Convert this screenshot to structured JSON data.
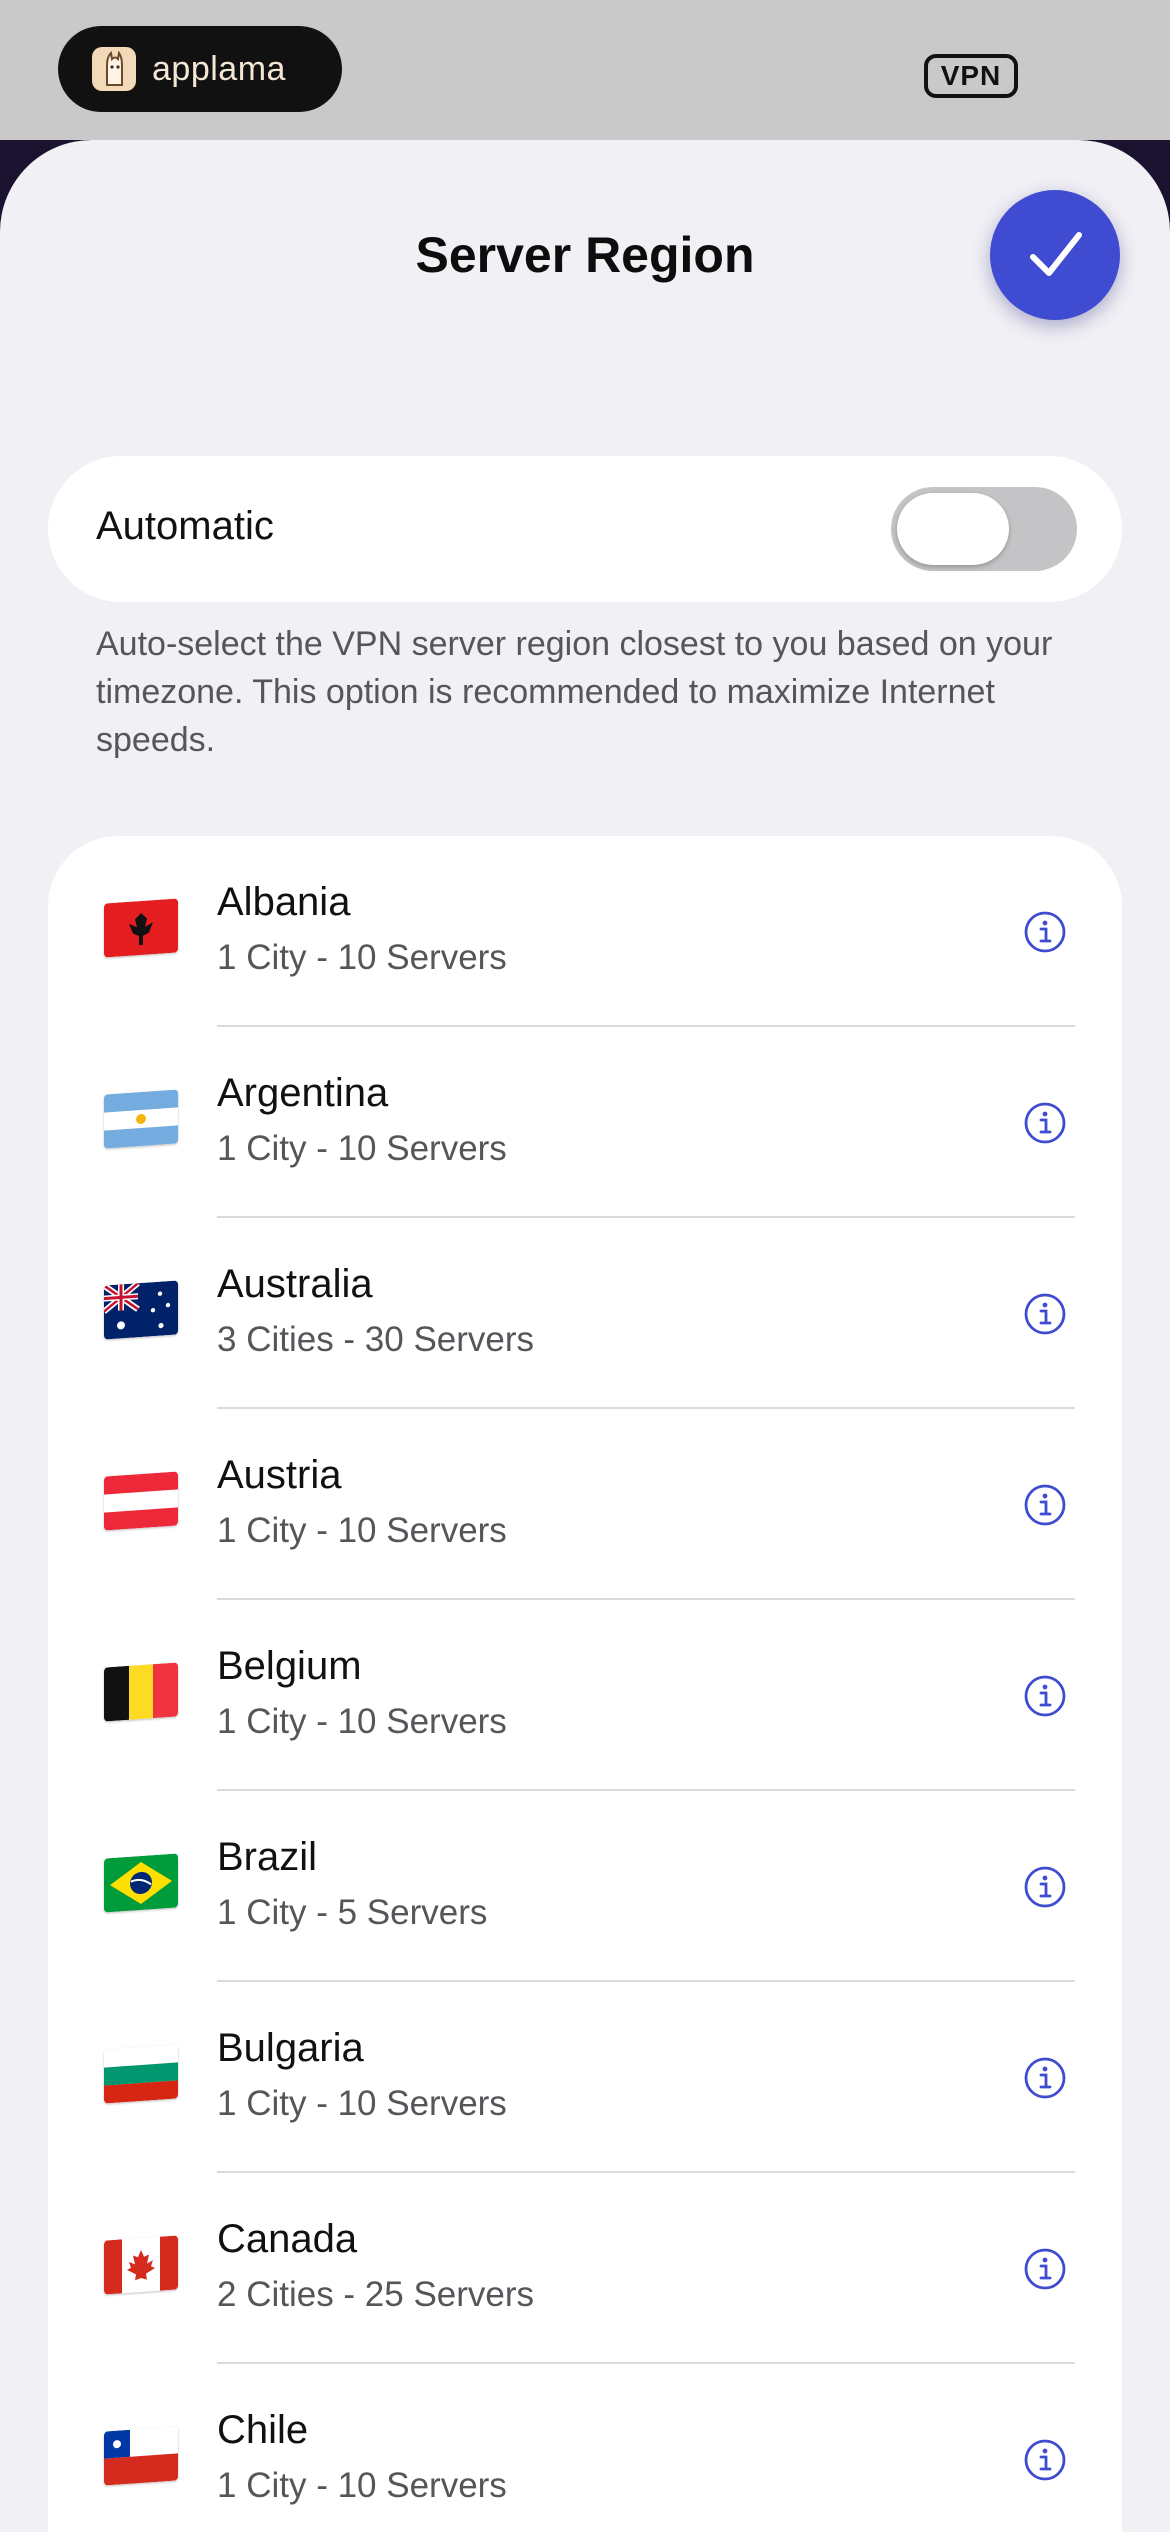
{
  "status_bar": {
    "brand_name": "applama",
    "badge": "VPN"
  },
  "header": {
    "title": "Server Region",
    "done_icon": "checkmark-icon"
  },
  "automatic": {
    "label": "Automatic",
    "toggle_on": false,
    "description": "Auto-select the VPN server region closest to you based on your timezone. This option is recommended to maximize Internet speeds."
  },
  "colors": {
    "accent": "#3f4bd1",
    "sheet_bg": "#f1f0f5",
    "secondary_text": "#55555a"
  },
  "regions": [
    {
      "name": "Albania",
      "detail": "1 City - 10 Servers",
      "flag": "albania-flag-icon"
    },
    {
      "name": "Argentina",
      "detail": "1 City - 10 Servers",
      "flag": "argentina-flag-icon"
    },
    {
      "name": "Australia",
      "detail": "3 Cities - 30 Servers",
      "flag": "australia-flag-icon"
    },
    {
      "name": "Austria",
      "detail": "1 City - 10 Servers",
      "flag": "austria-flag-icon"
    },
    {
      "name": "Belgium",
      "detail": "1 City - 10 Servers",
      "flag": "belgium-flag-icon"
    },
    {
      "name": "Brazil",
      "detail": "1 City - 5 Servers",
      "flag": "brazil-flag-icon"
    },
    {
      "name": "Bulgaria",
      "detail": "1 City - 10 Servers",
      "flag": "bulgaria-flag-icon"
    },
    {
      "name": "Canada",
      "detail": "2 Cities - 25 Servers",
      "flag": "canada-flag-icon"
    },
    {
      "name": "Chile",
      "detail": "1 City - 10 Servers",
      "flag": "chile-flag-icon"
    }
  ]
}
